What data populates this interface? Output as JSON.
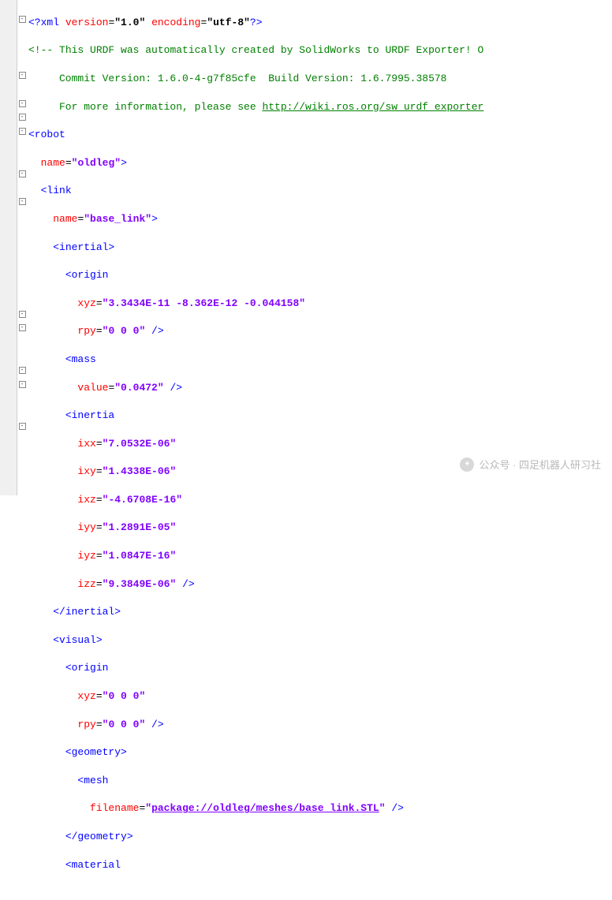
{
  "xml_decl": {
    "pre": "<?",
    "name": "xml",
    "a1": "version",
    "v1": "\"1.0\"",
    "a2": "encoding",
    "v2": "\"utf-8\"",
    "post": "?>"
  },
  "comment": {
    "l1_open": "<!-- ",
    "l1": "This URDF was automatically created by SolidWorks to URDF Exporter! O",
    "l2": "     Commit Version: 1.6.0-4-g7f85cfe  Build Version: 1.6.7995.38578",
    "l3_pre": "     For more information, please see ",
    "l3_link": "http://wiki.ros.org/sw_urdf_exporter"
  },
  "robot_open": "<robot",
  "robot_name_attr": "name",
  "robot_name_val": "\"oldleg\"",
  "close_gt": ">",
  "link_open": "<link",
  "link_name_attr": "name",
  "link_name_val": "\"base_link\"",
  "inertial_open": "<inertial>",
  "origin_open": "<origin",
  "xyz_attr": "xyz",
  "xyz_val1": "\"3.3434E-11 -8.362E-12 -0.044158\"",
  "rpy_attr": "rpy",
  "rpy_val1": "\"0 0 0\"",
  "slash_close": " />",
  "mass_open": "<mass",
  "value_attr": "value",
  "mass_val": "\"0.0472\"",
  "inertia_open": "<inertia",
  "ixx_attr": "ixx",
  "ixx_val": "\"7.0532E-06\"",
  "ixy_attr": "ixy",
  "ixy_val": "\"1.4338E-06\"",
  "ixz_attr": "ixz",
  "ixz_val": "\"-4.6708E-16\"",
  "iyy_attr": "iyy",
  "iyy_val": "\"1.2891E-05\"",
  "iyz_attr": "iyz",
  "iyz_val": "\"1.0847E-16\"",
  "izz_attr": "izz",
  "izz_val": "\"9.3849E-06\"",
  "inertial_close": "</inertial>",
  "visual_open": "<visual>",
  "xyz_val2": "\"0 0 0\"",
  "rpy_val2": "\"0 0 0\"",
  "geometry_open": "<geometry>",
  "mesh_open": "<mesh",
  "filename_attr": "filename",
  "filename_val_pre": "\"",
  "filename_link": "package://oldleg/meshes/base_link.STL",
  "filename_val_post": "\"",
  "geometry_close": "</geometry>",
  "material_open": "<material",
  "watermark_text": "公众号 · 四足机器人研习社",
  "eq": "="
}
